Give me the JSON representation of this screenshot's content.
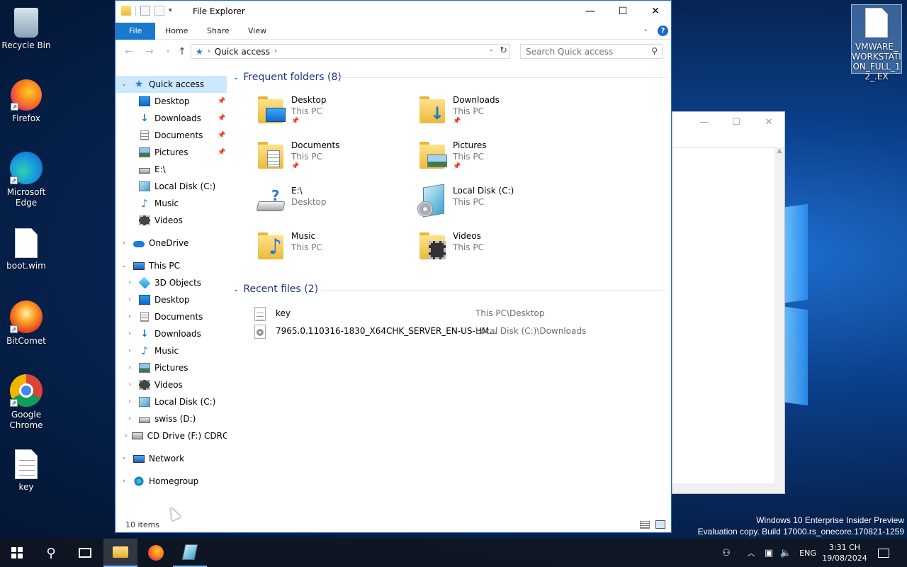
{
  "desktop": {
    "icons": [
      {
        "label": "Recycle Bin",
        "icon": "recycle-bin-icon"
      },
      {
        "label": "Firefox",
        "icon": "firefox-icon"
      },
      {
        "label": "Microsoft Edge",
        "icon": "edge-icon"
      },
      {
        "label": "boot.wim",
        "icon": "file-icon"
      },
      {
        "label": "BitComet",
        "icon": "bitcomet-icon"
      },
      {
        "label": "Google Chrome",
        "icon": "chrome-icon"
      },
      {
        "label": "key",
        "icon": "text-file-icon"
      }
    ],
    "selected_file": {
      "label": "VMWARE_WORKSTATION_FULL_12_.EX",
      "icon": "file-icon"
    }
  },
  "explorer": {
    "title": "File Explorer",
    "ribbon_tabs": [
      "File",
      "Home",
      "Share",
      "View"
    ],
    "address": {
      "current": "Quick access"
    },
    "search": {
      "placeholder": "Search Quick access"
    },
    "nav_pane": {
      "quick_access": {
        "label": "Quick access",
        "items": [
          {
            "label": "Desktop",
            "icon": "desktop-icon",
            "pinned": true
          },
          {
            "label": "Downloads",
            "icon": "downloads-icon",
            "pinned": true
          },
          {
            "label": "Documents",
            "icon": "documents-icon",
            "pinned": true
          },
          {
            "label": "Pictures",
            "icon": "pictures-icon",
            "pinned": true
          },
          {
            "label": "E:\\",
            "icon": "drive-icon",
            "pinned": false
          },
          {
            "label": "Local Disk (C:)",
            "icon": "local-disk-icon",
            "pinned": false
          },
          {
            "label": "Music",
            "icon": "music-icon",
            "pinned": false
          },
          {
            "label": "Videos",
            "icon": "videos-icon",
            "pinned": false
          }
        ]
      },
      "onedrive": {
        "label": "OneDrive"
      },
      "this_pc": {
        "label": "This PC",
        "items": [
          {
            "label": "3D Objects",
            "icon": "3d-objects-icon"
          },
          {
            "label": "Desktop",
            "icon": "desktop-icon"
          },
          {
            "label": "Documents",
            "icon": "documents-icon"
          },
          {
            "label": "Downloads",
            "icon": "downloads-icon"
          },
          {
            "label": "Music",
            "icon": "music-icon"
          },
          {
            "label": "Pictures",
            "icon": "pictures-icon"
          },
          {
            "label": "Videos",
            "icon": "videos-icon"
          },
          {
            "label": "Local Disk (C:)",
            "icon": "local-disk-icon"
          },
          {
            "label": "swiss (D:)",
            "icon": "drive-icon"
          },
          {
            "label": "CD Drive (F:) CDROI",
            "icon": "cd-drive-icon"
          }
        ]
      },
      "network": {
        "label": "Network"
      },
      "homegroup": {
        "label": "Homegroup"
      }
    },
    "frequent_folders": {
      "header": "Frequent folders (8)",
      "items": [
        {
          "name": "Desktop",
          "location": "This PC",
          "pinned": true,
          "icon": "desktop-folder-icon"
        },
        {
          "name": "Downloads",
          "location": "This PC",
          "pinned": true,
          "icon": "downloads-folder-icon"
        },
        {
          "name": "Documents",
          "location": "This PC",
          "pinned": true,
          "icon": "documents-folder-icon"
        },
        {
          "name": "Pictures",
          "location": "This PC",
          "pinned": true,
          "icon": "pictures-folder-icon"
        },
        {
          "name": "E:\\",
          "location": "Desktop",
          "pinned": false,
          "icon": "drive-icon"
        },
        {
          "name": "Local Disk (C:)",
          "location": "This PC",
          "pinned": false,
          "icon": "local-disk-icon"
        },
        {
          "name": "Music",
          "location": "This PC",
          "pinned": false,
          "icon": "music-folder-icon"
        },
        {
          "name": "Videos",
          "location": "This PC",
          "pinned": false,
          "icon": "videos-folder-icon"
        }
      ]
    },
    "recent_files": {
      "header": "Recent files (2)",
      "items": [
        {
          "name": "key",
          "path": "This PC\\Desktop",
          "icon": "text-file-icon"
        },
        {
          "name": "7965.0.110316-1830_X64CHK_SERVER_EN-US-HM...",
          "path": "Local Disk (C:)\\Downloads",
          "icon": "disc-image-icon"
        }
      ]
    },
    "status": {
      "items": "10 items"
    }
  },
  "watermark": {
    "line1": "Windows 10 Enterprise Insider Preview",
    "line2": "Evaluation copy. Build 17000.rs_onecore.170821-1259"
  },
  "taskbar": {
    "language": "ENG",
    "time": "3:31 CH",
    "date": "19/08/2024"
  }
}
